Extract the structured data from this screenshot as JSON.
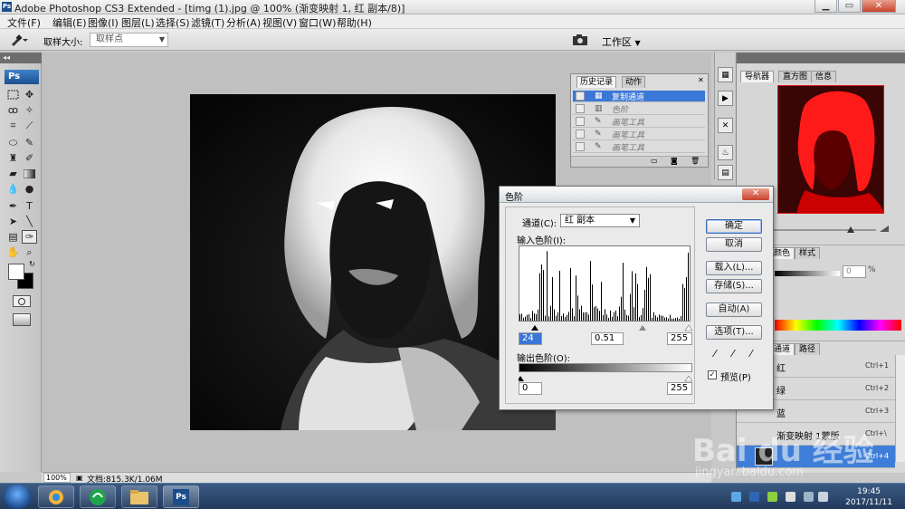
{
  "window": {
    "title": "Adobe Photoshop CS3 Extended - [timg (1).jpg @ 100% (渐变映射 1, 红 副本/8)]",
    "app_icon": "Ps",
    "controls": [
      "minimize",
      "maximize",
      "close"
    ]
  },
  "menubar": {
    "items": [
      "文件(F)",
      "编辑(E)",
      "图像(I)",
      "图层(L)",
      "选择(S)",
      "滤镜(T)",
      "分析(A)",
      "视图(V)",
      "窗口(W)",
      "帮助(H)"
    ]
  },
  "options_bar": {
    "sample_size_label": "取样大小:",
    "sample_size_value": "取样点",
    "workspace_label": "工作区"
  },
  "toolbox": {
    "logo": "Ps",
    "active_tool": "eyedropper-tool"
  },
  "status_bar": {
    "zoom": "100%",
    "doc_info": "文档:815.3K/1.06M"
  },
  "history_panel": {
    "tabs": [
      "历史记录",
      "动作"
    ],
    "items": [
      {
        "label": "复制通道",
        "selected": true
      },
      {
        "label": "色阶",
        "selected": false
      },
      {
        "label": "画笔工具",
        "selected": false
      },
      {
        "label": "画笔工具",
        "selected": false
      },
      {
        "label": "画笔工具",
        "selected": false
      }
    ]
  },
  "navigator_panel": {
    "tabs": [
      "导航器",
      "直方图",
      "信息"
    ]
  },
  "color_panel": {
    "tabs": [
      "颜色",
      "样式"
    ],
    "value": "0",
    "unit": "%"
  },
  "channels_panel": {
    "tabs": [
      "通道",
      "路径"
    ],
    "items": [
      {
        "name": "红",
        "shortcut": "Ctrl+1",
        "selected": false
      },
      {
        "name": "绿",
        "shortcut": "Ctrl+2",
        "selected": false
      },
      {
        "name": "蓝",
        "shortcut": "Ctrl+3",
        "selected": false
      },
      {
        "name": "渐变映射 1蒙版",
        "shortcut": "Ctrl+\\",
        "selected": false
      },
      {
        "name": "",
        "shortcut": "Ctrl+4",
        "selected": true
      }
    ]
  },
  "levels_dialog": {
    "title": "色阶",
    "channel_label": "通道(C):",
    "channel_value": "红 副本",
    "input_label": "输入色阶(I):",
    "input_black": "24",
    "input_gamma": "0.51",
    "input_white": "255",
    "output_label": "输出色阶(O):",
    "output_black": "0",
    "output_white": "255",
    "buttons": {
      "ok": "确定",
      "cancel": "取消",
      "load": "载入(L)...",
      "save": "存储(S)...",
      "auto": "自动(A)",
      "options": "选项(T)..."
    },
    "preview_label": "预览(P)",
    "preview_checked": true
  },
  "taskbar": {
    "time": "19:45",
    "date": "2017/11/11"
  },
  "watermark": {
    "brand": "Bai du 经验",
    "url": "jingyan.baidu.com"
  },
  "colors": {
    "selection_blue": "#3b77d6",
    "nav_red": "#e01010"
  }
}
